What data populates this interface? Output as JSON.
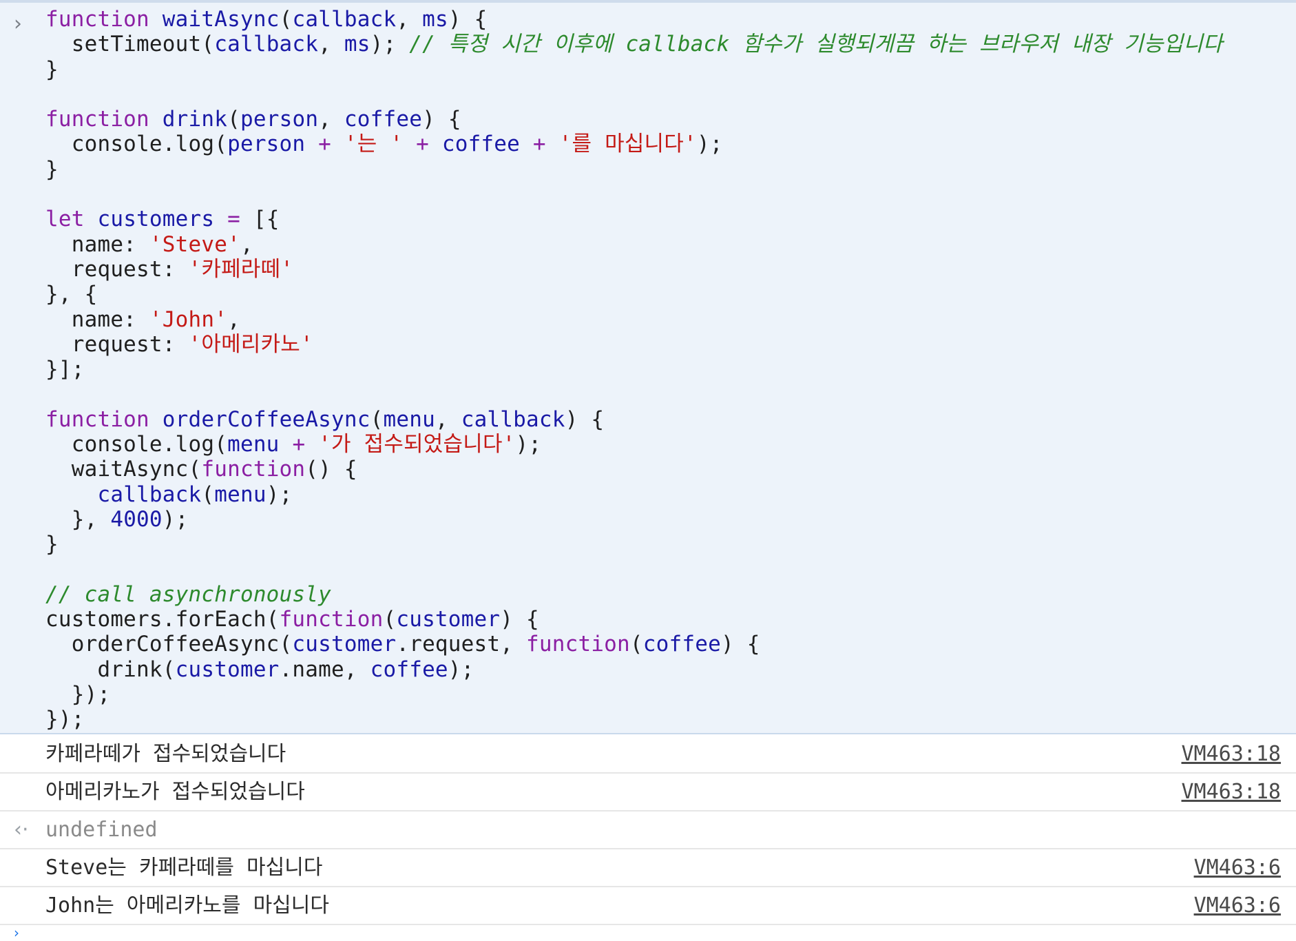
{
  "console": {
    "input": {
      "prompt_icon": "chevron-right-icon",
      "lines": [
        [
          [
            "kw",
            "function"
          ],
          [
            "p",
            " "
          ],
          [
            "fn",
            "waitAsync"
          ],
          [
            "p",
            "("
          ],
          [
            "vr",
            "callback"
          ],
          [
            "p",
            ", "
          ],
          [
            "vr",
            "ms"
          ],
          [
            "p",
            ") {"
          ]
        ],
        [
          [
            "p",
            "  setTimeout("
          ],
          [
            "vr",
            "callback"
          ],
          [
            "p",
            ", "
          ],
          [
            "vr",
            "ms"
          ],
          [
            "p",
            "); "
          ],
          [
            "cm",
            "// 특정 시간 이후에 callback 함수가 실행되게끔 하는 브라우저 내장 기능입니다"
          ]
        ],
        [
          [
            "p",
            "}"
          ]
        ],
        [
          [
            "p",
            ""
          ]
        ],
        [
          [
            "kw",
            "function"
          ],
          [
            "p",
            " "
          ],
          [
            "fn",
            "drink"
          ],
          [
            "p",
            "("
          ],
          [
            "vr",
            "person"
          ],
          [
            "p",
            ", "
          ],
          [
            "vr",
            "coffee"
          ],
          [
            "p",
            ") {"
          ]
        ],
        [
          [
            "p",
            "  console.log("
          ],
          [
            "vr",
            "person"
          ],
          [
            "p",
            " "
          ],
          [
            "op",
            "+"
          ],
          [
            "p",
            " "
          ],
          [
            "st",
            "'는 '"
          ],
          [
            "p",
            " "
          ],
          [
            "op",
            "+"
          ],
          [
            "p",
            " "
          ],
          [
            "vr",
            "coffee"
          ],
          [
            "p",
            " "
          ],
          [
            "op",
            "+"
          ],
          [
            "p",
            " "
          ],
          [
            "st",
            "'를 마십니다'"
          ],
          [
            "p",
            ");"
          ]
        ],
        [
          [
            "p",
            "}"
          ]
        ],
        [
          [
            "p",
            ""
          ]
        ],
        [
          [
            "kw",
            "let"
          ],
          [
            "p",
            " "
          ],
          [
            "vr",
            "customers"
          ],
          [
            "p",
            " "
          ],
          [
            "op",
            "="
          ],
          [
            "p",
            " [{"
          ]
        ],
        [
          [
            "p",
            "  name: "
          ],
          [
            "st",
            "'Steve'"
          ],
          [
            "p",
            ","
          ]
        ],
        [
          [
            "p",
            "  request: "
          ],
          [
            "st",
            "'카페라떼'"
          ]
        ],
        [
          [
            "p",
            "}, {"
          ]
        ],
        [
          [
            "p",
            "  name: "
          ],
          [
            "st",
            "'John'"
          ],
          [
            "p",
            ","
          ]
        ],
        [
          [
            "p",
            "  request: "
          ],
          [
            "st",
            "'아메리카노'"
          ]
        ],
        [
          [
            "p",
            "}];"
          ]
        ],
        [
          [
            "p",
            ""
          ]
        ],
        [
          [
            "kw",
            "function"
          ],
          [
            "p",
            " "
          ],
          [
            "fn",
            "orderCoffeeAsync"
          ],
          [
            "p",
            "("
          ],
          [
            "vr",
            "menu"
          ],
          [
            "p",
            ", "
          ],
          [
            "vr",
            "callback"
          ],
          [
            "p",
            ") {"
          ]
        ],
        [
          [
            "p",
            "  console.log("
          ],
          [
            "vr",
            "menu"
          ],
          [
            "p",
            " "
          ],
          [
            "op",
            "+"
          ],
          [
            "p",
            " "
          ],
          [
            "st",
            "'가 접수되었습니다'"
          ],
          [
            "p",
            ");"
          ]
        ],
        [
          [
            "p",
            "  waitAsync("
          ],
          [
            "kw",
            "function"
          ],
          [
            "p",
            "() {"
          ]
        ],
        [
          [
            "p",
            "    "
          ],
          [
            "vr",
            "callback"
          ],
          [
            "p",
            "("
          ],
          [
            "vr",
            "menu"
          ],
          [
            "p",
            ");"
          ]
        ],
        [
          [
            "p",
            "  }, "
          ],
          [
            "nm",
            "4000"
          ],
          [
            "p",
            ");"
          ]
        ],
        [
          [
            "p",
            "}"
          ]
        ],
        [
          [
            "p",
            ""
          ]
        ],
        [
          [
            "cm",
            "// call asynchronously"
          ]
        ],
        [
          [
            "p",
            "customers.forEach("
          ],
          [
            "kw",
            "function"
          ],
          [
            "p",
            "("
          ],
          [
            "vr",
            "customer"
          ],
          [
            "p",
            ") {"
          ]
        ],
        [
          [
            "p",
            "  orderCoffeeAsync("
          ],
          [
            "vr",
            "customer"
          ],
          [
            "p",
            ".request, "
          ],
          [
            "kw",
            "function"
          ],
          [
            "p",
            "("
          ],
          [
            "vr",
            "coffee"
          ],
          [
            "p",
            ") {"
          ]
        ],
        [
          [
            "p",
            "    drink("
          ],
          [
            "vr",
            "customer"
          ],
          [
            "p",
            ".name, "
          ],
          [
            "vr",
            "coffee"
          ],
          [
            "p",
            ");"
          ]
        ],
        [
          [
            "p",
            "  });"
          ]
        ],
        [
          [
            "p",
            "});"
          ]
        ]
      ]
    },
    "outputs": [
      {
        "type": "log",
        "text": "카페라떼가 접수되었습니다",
        "source": "VM463:18"
      },
      {
        "type": "log",
        "text": "아메리카노가 접수되었습니다",
        "source": "VM463:18"
      },
      {
        "type": "return",
        "icon": "return-arrow-icon",
        "text": "undefined"
      },
      {
        "type": "log",
        "text": "Steve는 카페라떼를 마십니다",
        "source": "VM463:6"
      },
      {
        "type": "log",
        "text": "John는 아메리카노를 마십니다",
        "source": "VM463:6"
      }
    ],
    "next_prompt_icon": "chevron-right-icon"
  }
}
